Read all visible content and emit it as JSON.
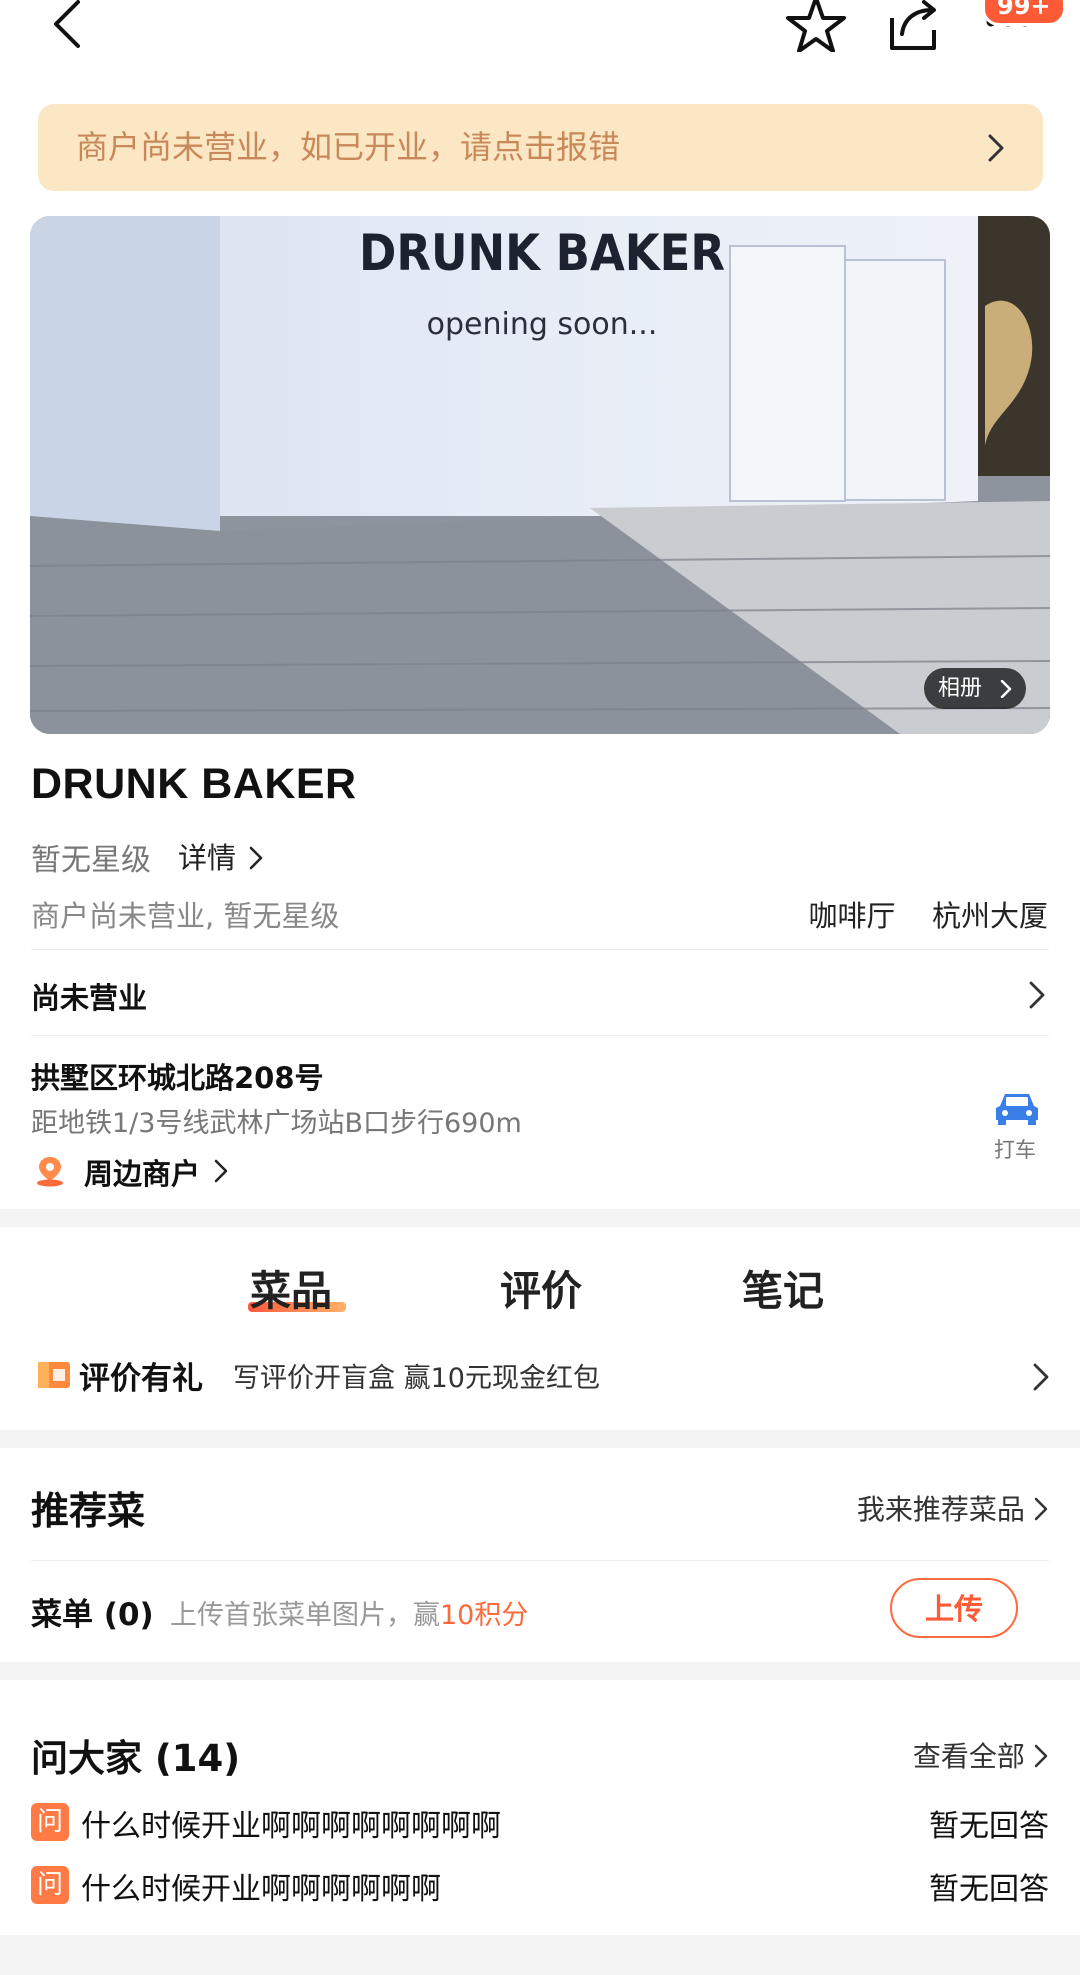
{
  "topbar": {
    "badge": "99+",
    "icons": [
      "back-arrow-icon",
      "star-icon",
      "share-icon",
      "more-icon"
    ]
  },
  "notice": {
    "text": "商户尚未营业，如已开业，请点击报错"
  },
  "photo": {
    "sign_title": "DRUNK BAKER",
    "sign_subtitle": "opening soon...",
    "album_label": "相册"
  },
  "shop": {
    "name": "DRUNK BAKER",
    "rating_text": "暂无星级",
    "detail_label": "详情",
    "status_text": "商户尚未营业, 暂无星级",
    "category": "咖啡厅",
    "area": "杭州大厦"
  },
  "hours": {
    "label": "尚未营业"
  },
  "address": {
    "street": "拱墅区环城北路208号",
    "transit": "距地铁1/3号线武林广场站B口步行690m",
    "nearby_label": "周边商户",
    "taxi_label": "打车"
  },
  "tabs": [
    {
      "label": "菜品",
      "active": true
    },
    {
      "label": "评价",
      "active": false
    },
    {
      "label": "笔记",
      "active": false
    }
  ],
  "review_promo": {
    "title": "评价有礼",
    "desc": "写评价开盲盒 赢10元现金红包"
  },
  "recommend": {
    "title": "推荐菜",
    "action": "我来推荐菜品"
  },
  "menu": {
    "title": "菜单 (0)",
    "hint": "上传首张菜单图片，赢",
    "reward": "10积分",
    "upload_label": "上传"
  },
  "qa": {
    "title": "问大家 (14)",
    "view_all": "查看全部",
    "icon_text": "问",
    "items": [
      {
        "question": "什么时候开业啊啊啊啊啊啊啊啊",
        "status": "暂无回答"
      },
      {
        "question": "什么时候开业啊啊啊啊啊啊",
        "status": "暂无回答"
      }
    ]
  },
  "colors": {
    "accent": "#ff6a3d",
    "notice_bg": "#fbe7c3",
    "notice_text": "#c8895a",
    "taxi_blue": "#3a7ee8"
  }
}
